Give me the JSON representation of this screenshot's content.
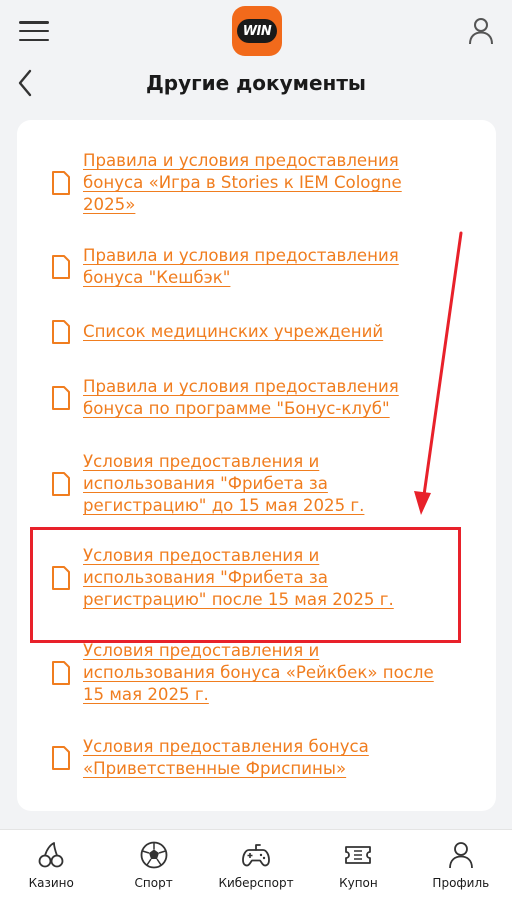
{
  "app": {
    "logo_text": "WIN"
  },
  "header": {
    "title": "Другие документы"
  },
  "documents": [
    {
      "label": "Правила и условия предоставления бонуса «Игра в Stories к IEM Cologne 2025»"
    },
    {
      "label": "Правила и условия предоставления бонуса \"Кешбэк\""
    },
    {
      "label": "Список медицинских учреждений"
    },
    {
      "label": "Правила и условия предоставления бонуса по программе \"Бонус-клуб\""
    },
    {
      "label": "Условия предоставления и использования \"Фрибета за регистрацию\" до 15 мая 2025 г."
    },
    {
      "label": "Условия предоставления и использования \"Фрибета за регистрацию\" после 15 мая 2025 г."
    },
    {
      "label": "Условия предоставления и использования бонуса «Рейкбек» после 15 мая 2025 г."
    },
    {
      "label": "Условия предоставления бонуса «Приветственные Фриспины»"
    }
  ],
  "bottom_nav": [
    {
      "label": "Казино",
      "icon": "cherries-icon"
    },
    {
      "label": "Спорт",
      "icon": "soccer-ball-icon"
    },
    {
      "label": "Киберспорт",
      "icon": "gamepad-icon"
    },
    {
      "label": "Купон",
      "icon": "ticket-icon"
    },
    {
      "label": "Профиль",
      "icon": "user-icon"
    }
  ],
  "colors": {
    "link": "#f07d1f",
    "brand": "#f26a1b",
    "highlight": "#e8212a",
    "background": "#f2f3f5"
  }
}
